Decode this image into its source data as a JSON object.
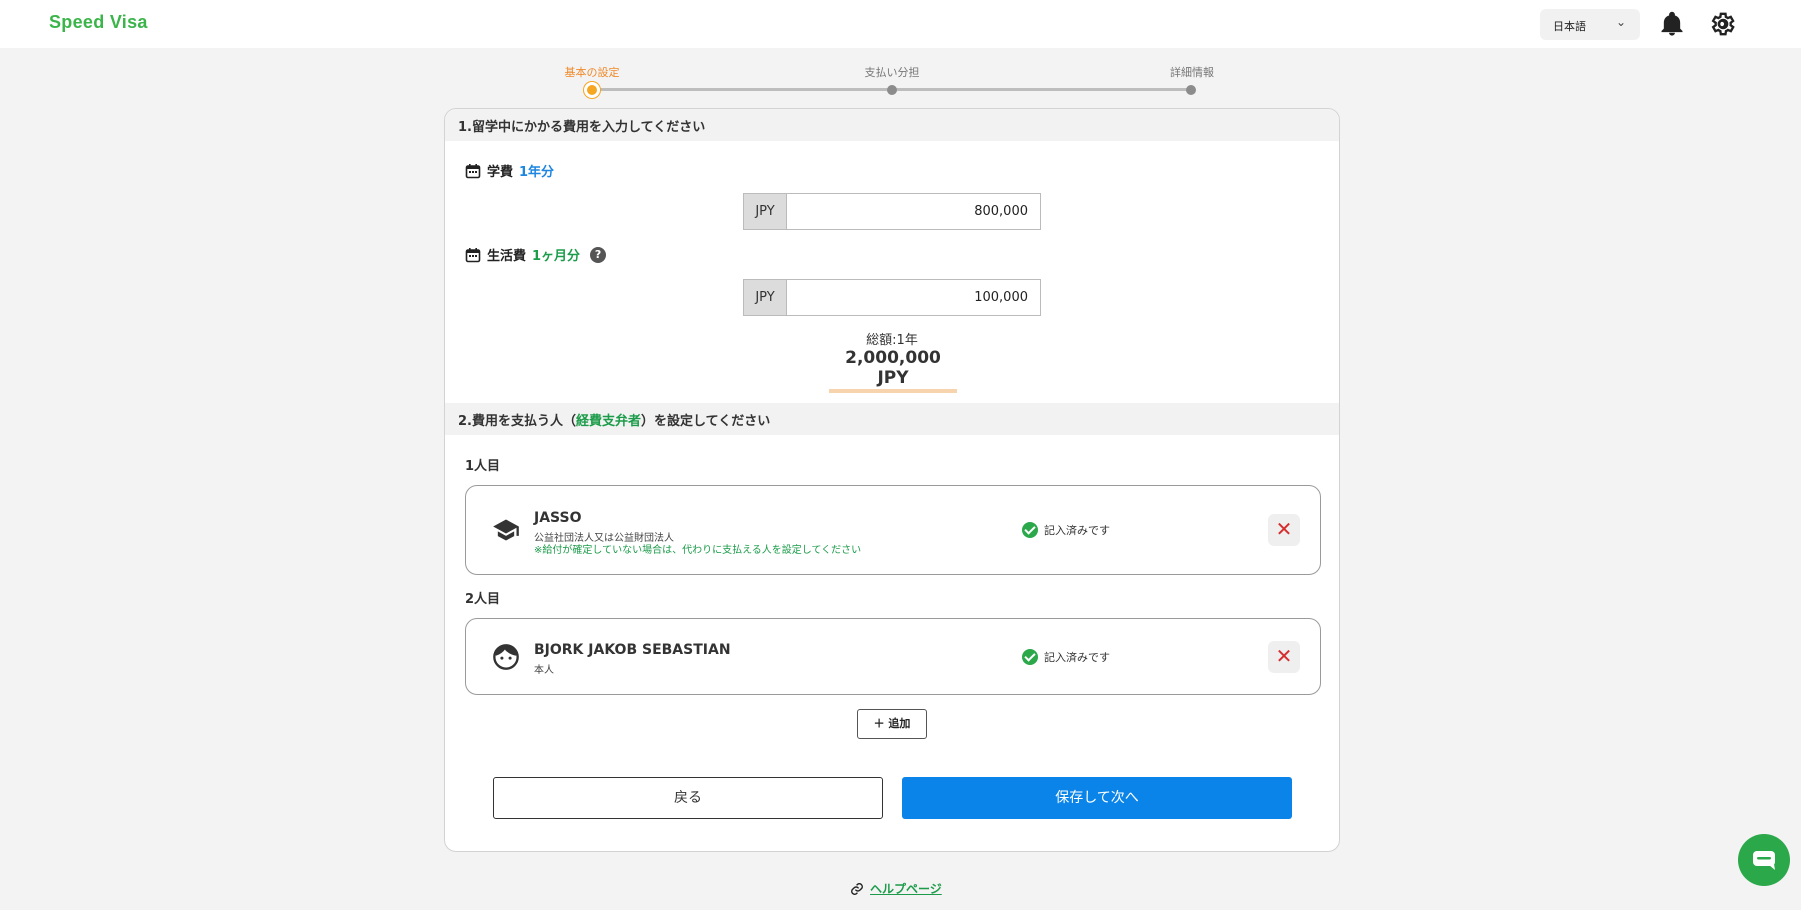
{
  "header": {
    "logo": "Speed Visa",
    "language": "日本語",
    "icons": [
      "bell-icon",
      "gear-icon"
    ]
  },
  "stepper": {
    "steps": [
      "基本の設定",
      "支払い分担",
      "詳細情報"
    ],
    "active_index": 0
  },
  "section1": {
    "title": "1.留学中にかかる費用を入力してください",
    "tuition": {
      "label": "学費",
      "period": "1年分",
      "currency": "JPY",
      "value": "800,000"
    },
    "living": {
      "label": "生活費",
      "period": "1ヶ月分",
      "help": "?",
      "currency": "JPY",
      "value": "100,000"
    },
    "total_label": "総額:1年",
    "total_value": "2,000,000 JPY"
  },
  "section2": {
    "title_before": "2.費用を支払う人（",
    "title_highlight": "経費支弁者",
    "title_after": "）を設定してください",
    "persons": [
      {
        "number_label": "1人目",
        "icon": "graduation-cap-icon",
        "name": "JASSO",
        "subtitle": "公益社団法人又は公益財団法人",
        "note": "※給付が確定していない場合は、代わりに支払える人を設定してください",
        "status": "記入済みです",
        "delete": "✕"
      },
      {
        "number_label": "2人目",
        "icon": "face-icon",
        "name": "BJORK JAKOB SEBASTIAN",
        "subtitle": "本人",
        "status": "記入済みです",
        "delete": "✕"
      }
    ],
    "add_label": "追加"
  },
  "actions": {
    "back_label": "戻る",
    "next_label": "保存して次へ"
  },
  "footer": {
    "help_link": "ヘルプページ"
  },
  "colors": {
    "brand_green": "#3bb54a",
    "accent_orange": "#f5a623",
    "primary_blue": "#0a84e8",
    "danger_red": "#d62d2d"
  }
}
